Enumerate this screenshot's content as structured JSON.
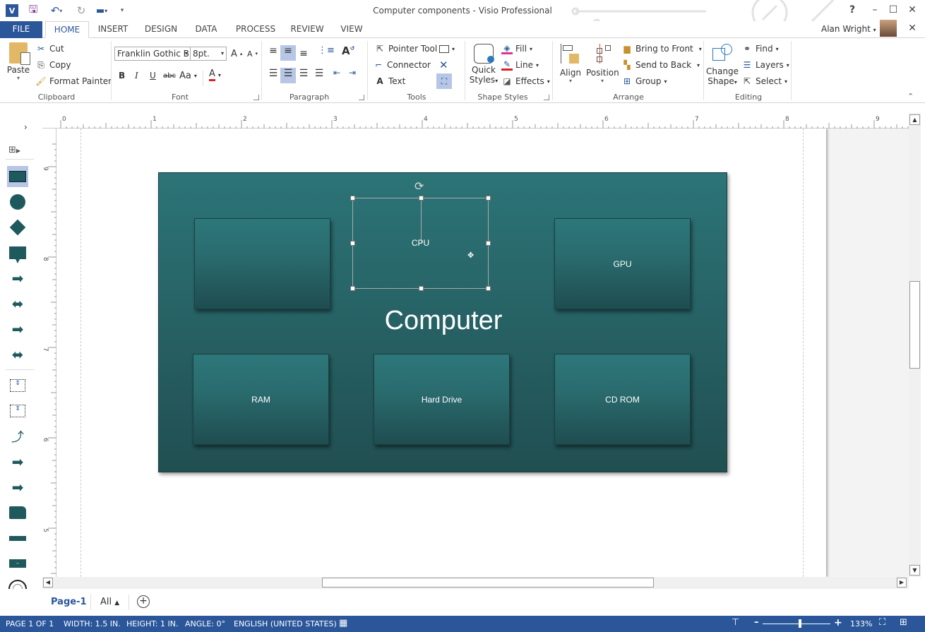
{
  "window": {
    "title": "Computer components - Visio Professional",
    "user": "Alan Wright"
  },
  "qat": {
    "app_icon": "visio-icon",
    "save": "save-icon",
    "undo": "undo-icon",
    "redo": "redo-icon",
    "customize": "customize-qat-icon"
  },
  "tabs": [
    "FILE",
    "HOME",
    "INSERT",
    "DESIGN",
    "DATA",
    "PROCESS",
    "REVIEW",
    "VIEW"
  ],
  "active_tab": "HOME",
  "ribbon": {
    "clipboard": {
      "label": "Clipboard",
      "paste": "Paste",
      "cut": "Cut",
      "copy": "Copy",
      "format_painter": "Format Painter"
    },
    "font": {
      "label": "Font",
      "font_name": "Franklin Gothic B",
      "font_size": "8pt.",
      "bold": "B",
      "italic": "I",
      "underline": "U",
      "strike": "abc",
      "case": "Aa",
      "color": "A",
      "grow": "A",
      "shrink": "A"
    },
    "paragraph": {
      "label": "Paragraph"
    },
    "tools": {
      "label": "Tools",
      "pointer": "Pointer Tool",
      "connector": "Connector",
      "text": "Text"
    },
    "shape_styles": {
      "label": "Shape Styles",
      "quick_styles_1": "Quick",
      "quick_styles_2": "Styles",
      "fill": "Fill",
      "line": "Line",
      "effects": "Effects",
      "fill_color": "#e0338f",
      "line_color": "#e02020"
    },
    "arrange": {
      "label": "Arrange",
      "align": "Align",
      "position": "Position",
      "bring_front": "Bring to Front",
      "send_back": "Send to Back",
      "group": "Group"
    },
    "editing": {
      "label": "Editing",
      "change_shape_1": "Change",
      "change_shape_2": "Shape",
      "find": "Find",
      "layers": "Layers",
      "select": "Select"
    }
  },
  "rulers": {
    "horizontal": [
      "0",
      "1",
      "2",
      "3",
      "4",
      "5",
      "6",
      "7",
      "8",
      "9"
    ],
    "vertical": [
      "9",
      "8",
      "7",
      "6",
      "5"
    ]
  },
  "diagram": {
    "container_title": "Computer",
    "shapes": [
      {
        "label": "",
        "id": "blank"
      },
      {
        "label": "CPU",
        "id": "cpu",
        "selected": true
      },
      {
        "label": "GPU",
        "id": "gpu"
      },
      {
        "label": "RAM",
        "id": "ram"
      },
      {
        "label": "Hard Drive",
        "id": "hard-drive"
      },
      {
        "label": "CD ROM",
        "id": "cd-rom"
      }
    ],
    "color_top": "#2c7477",
    "color_bottom": "#1f4d50"
  },
  "page_tabs": {
    "page": "Page-1",
    "all": "All"
  },
  "status": {
    "page": "PAGE 1 OF 1",
    "width": "WIDTH: 1.5 IN.",
    "height": "HEIGHT: 1 IN.",
    "angle": "ANGLE: 0°",
    "language": "ENGLISH (UNITED STATES)",
    "zoom": "133%",
    "zoom_fraction": 0.55
  }
}
